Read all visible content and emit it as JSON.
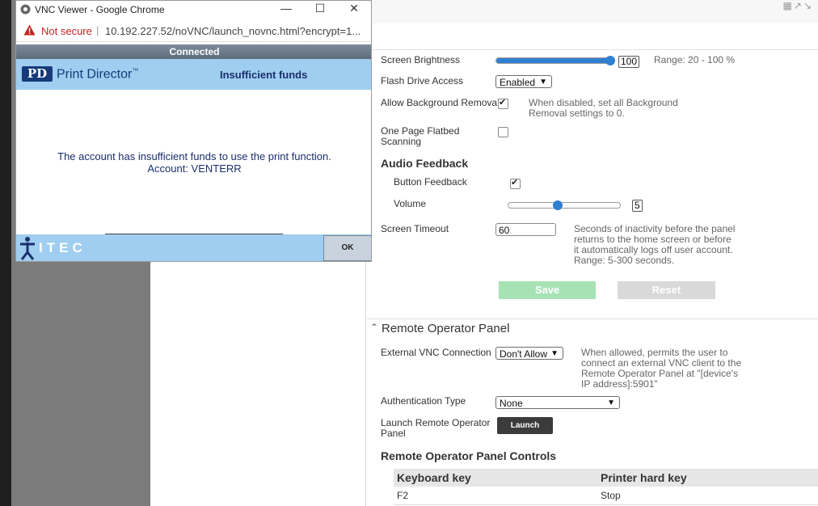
{
  "vnc_window": {
    "title": "VNC Viewer - Google Chrome",
    "minimize_icon": "minimize-icon",
    "maximize_icon": "maximize-icon",
    "close_icon": "close-icon",
    "security_warning": "Not secure",
    "url": "10.192.227.52/noVNC/launch_novnc.html?encrypt=1...",
    "status": "Connected",
    "app_name": "Print Director",
    "app_logo": "PD",
    "dialog_title": "Insufficient funds",
    "message_line1": "The account has insufficient funds to use the print function.",
    "message_line2": "Account: VENTERR",
    "footer_logo": "ITEC",
    "ok_label": "OK"
  },
  "settings": {
    "screen_brightness": {
      "label": "Screen Brightness",
      "value": "100",
      "level": 1.0,
      "range": "Range: 20 - 100 %"
    },
    "flash_drive": {
      "label": "Flash Drive Access",
      "value": "Enabled"
    },
    "background_removal": {
      "label": "Allow Background Removal",
      "checked": true,
      "hint_line1": "When disabled, set all Background",
      "hint_line2": "Removal settings to 0."
    },
    "flatbed": {
      "label_line1": "One Page Flatbed",
      "label_line2": "Scanning",
      "checked": false
    },
    "audio_feedback": {
      "title": "Audio Feedback",
      "button_feedback": {
        "label": "Button Feedback",
        "checked": true
      },
      "volume": {
        "label": "Volume",
        "value": "5",
        "level": 0.45
      }
    },
    "screen_timeout": {
      "label": "Screen Timeout",
      "value": "60",
      "hint_line1": "Seconds of inactivity before the panel",
      "hint_line2": "returns to the home screen or before",
      "hint_line3": "it automatically logs off user account.",
      "hint_line4": "Range: 5-300 seconds."
    },
    "save_label": "Save",
    "reset_label": "Reset",
    "save_color": "#a6e2b4",
    "reset_color": "#d9d9d9"
  },
  "remote_panel": {
    "title": "Remote Operator Panel",
    "external_vnc": {
      "label": "External VNC Connection",
      "value": "Don't Allow",
      "hint_line1": "When allowed, permits the user to",
      "hint_line2": "connect an external VNC client to the",
      "hint_line3": "Remote Operator Panel at \"[device's",
      "hint_line4": "IP address]:5901\""
    },
    "auth_type": {
      "label": "Authentication Type",
      "value": "None"
    },
    "launch": {
      "label_line1": "Launch Remote Operator",
      "label_line2": "Panel",
      "button": "Launch"
    },
    "controls_title": "Remote Operator Panel Controls",
    "table": {
      "headers": [
        "Keyboard key",
        "Printer hard key"
      ],
      "rows": [
        [
          "F2",
          "Stop"
        ]
      ]
    }
  }
}
